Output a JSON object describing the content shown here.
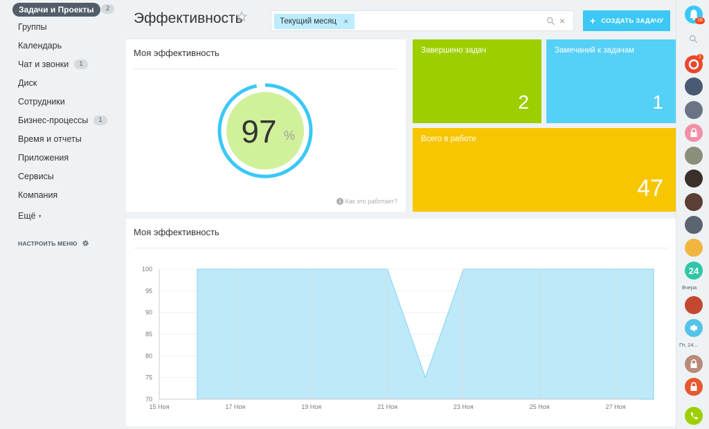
{
  "sidebar": {
    "active": {
      "label": "Задачи и Проекты",
      "count": "2"
    },
    "items": [
      {
        "label": "Группы",
        "count": ""
      },
      {
        "label": "Календарь",
        "count": ""
      },
      {
        "label": "Чат и звонки",
        "count": "1"
      },
      {
        "label": "Диск",
        "count": ""
      },
      {
        "label": "Сотрудники",
        "count": ""
      },
      {
        "label": "Бизнес-процессы",
        "count": "1"
      },
      {
        "label": "Время и отчеты",
        "count": ""
      },
      {
        "label": "Приложения",
        "count": ""
      },
      {
        "label": "Сервисы",
        "count": ""
      },
      {
        "label": "Компания",
        "count": ""
      }
    ],
    "more": "Ещё",
    "configure": "НАСТРОИТЬ МЕНЮ"
  },
  "header": {
    "title": "Эффективность",
    "filter_tag": "Текущий месяц",
    "create_button": "СОЗДАТЬ ЗАДАЧУ"
  },
  "my_efficiency": {
    "title": "Моя эффективность",
    "value": "97",
    "unit": "%",
    "percent": 97,
    "how_it_works": "Как это работает?"
  },
  "tiles": {
    "completed": {
      "title": "Завершено задач",
      "value": "2",
      "color": "#9dcf00"
    },
    "remarks": {
      "title": "Замечаний к задачам",
      "value": "1",
      "color": "#55d0f7"
    },
    "in_work": {
      "title": "Всего в работе",
      "value": "47",
      "color": "#f7c600"
    }
  },
  "chart_panel": {
    "title": "Моя эффективность"
  },
  "chart_data": {
    "type": "area",
    "title": "Моя эффективность",
    "x": [
      "16 Ноя",
      "17 Ноя",
      "18 Ноя",
      "19 Ноя",
      "20 Ноя",
      "21 Ноя",
      "22 Ноя",
      "23 Ноя",
      "24 Ноя",
      "25 Ноя",
      "26 Ноя",
      "27 Ноя",
      "28 Ноя"
    ],
    "x_start": "16 Ноя",
    "values": [
      100,
      100,
      100,
      100,
      100,
      100,
      75,
      100,
      100,
      100,
      100,
      100,
      100
    ],
    "ylim": [
      70,
      100
    ],
    "yticks": [
      70,
      75,
      80,
      85,
      90,
      95,
      100
    ],
    "xticks": [
      "15 Ноя",
      "17 Ноя",
      "19 Ноя",
      "21 Ноя",
      "23 Ноя",
      "25 Ноя",
      "27 Ноя"
    ],
    "color": "#bde9f9"
  },
  "rightbar": {
    "notification_count": "16",
    "unread_count": "1",
    "label_24": "24",
    "yesterday": "Вчера",
    "friday": "Пт, 24..."
  },
  "colors": {
    "accent": "#3bc8f5",
    "nav_active": "#535c69",
    "gauge_ring": "#3bc8f5",
    "gauge_fill": "#d0f09a"
  }
}
